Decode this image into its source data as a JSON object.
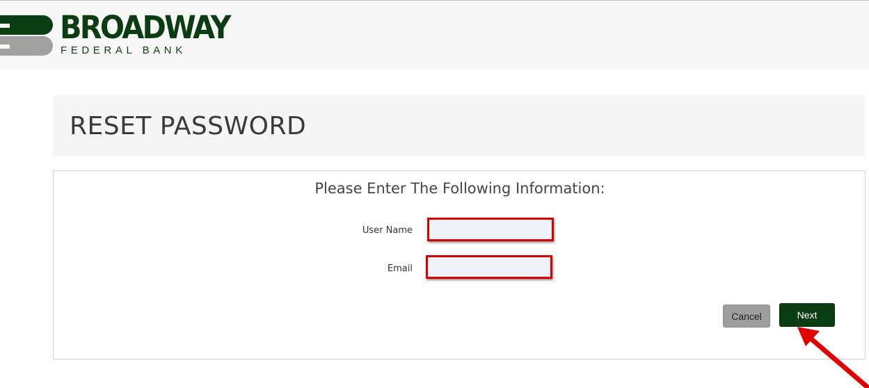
{
  "header": {
    "logo_word": "BROADWAY",
    "logo_sub": "FEDERAL BANK",
    "logo_icon": "broadway-b-mark-icon",
    "colors": {
      "brand_green": "#0b3d12",
      "mark_gray": "#a1a1a1"
    }
  },
  "page": {
    "title": "RESET PASSWORD"
  },
  "form": {
    "instructions": "Please Enter The Following Information:",
    "fields": [
      {
        "label": "User Name",
        "value": ""
      },
      {
        "label": "Email",
        "value": ""
      }
    ],
    "highlight_color": "#d90000",
    "buttons": {
      "cancel_label": "Cancel",
      "next_label": "Next"
    }
  },
  "annotation": {
    "icon": "red-pointer-arrow-icon",
    "color": "#e00000"
  }
}
